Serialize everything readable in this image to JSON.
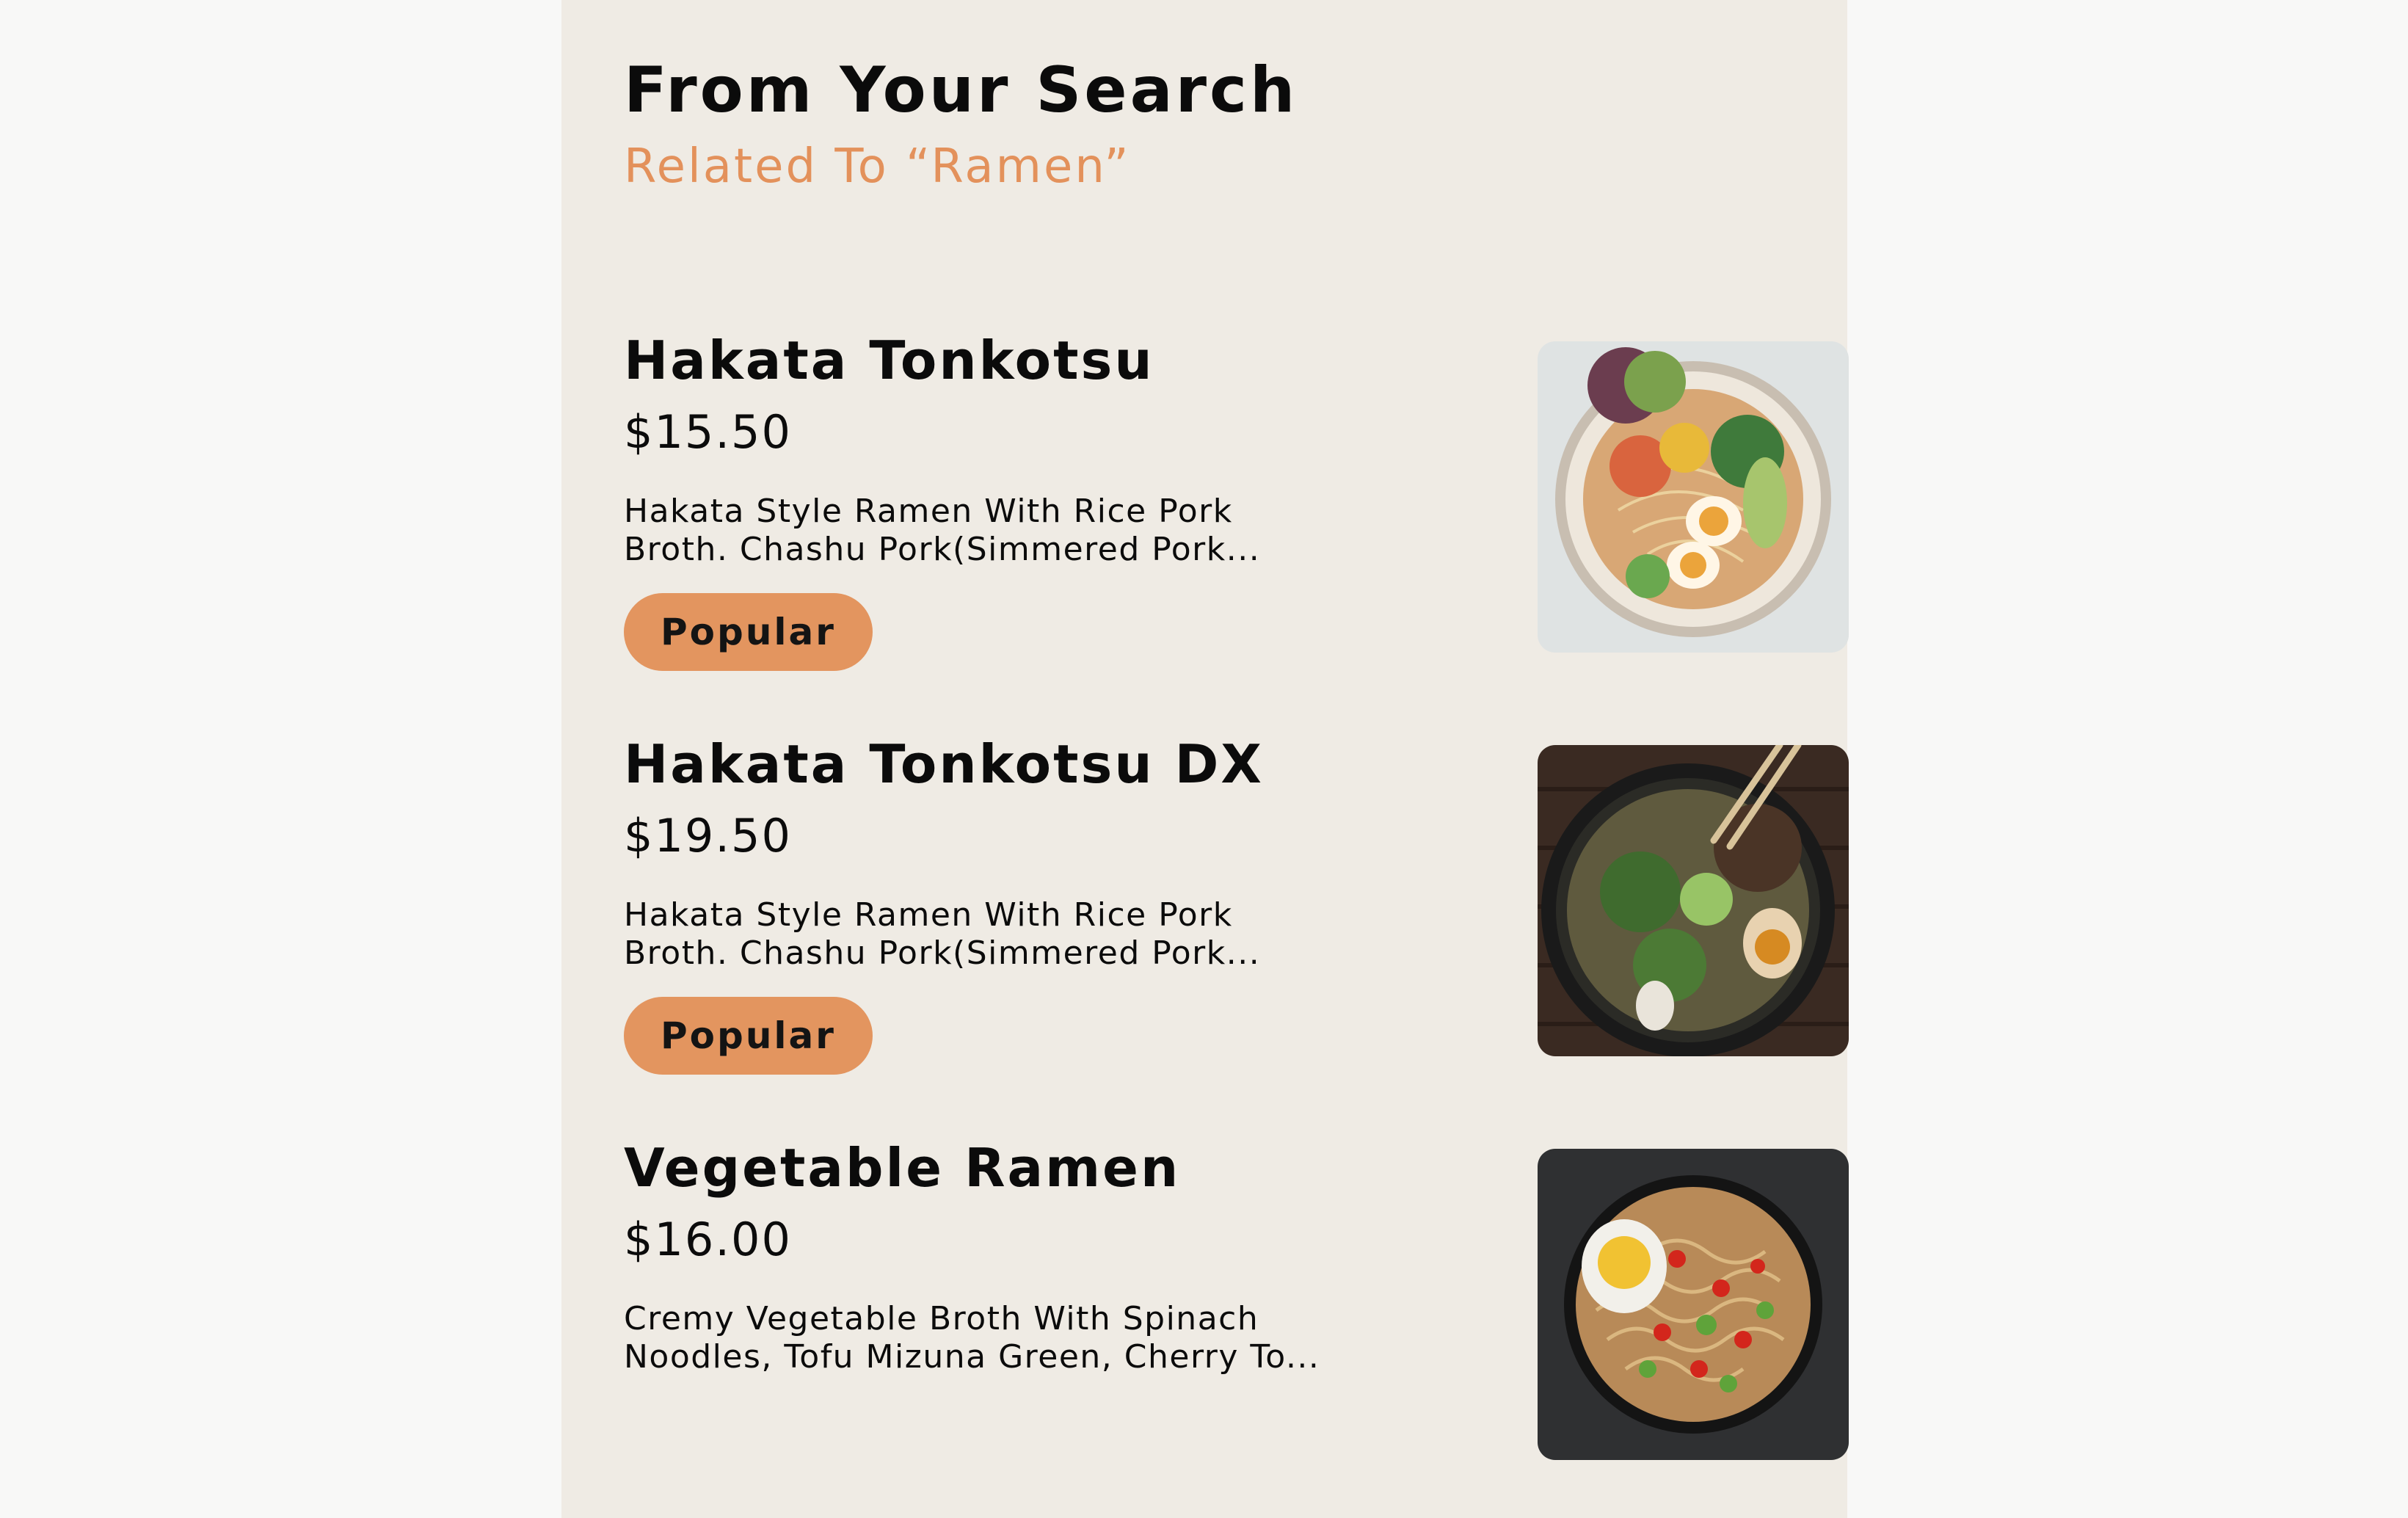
{
  "search": {
    "title": "From Your Search",
    "subtitle": "Related To “Ramen”"
  },
  "colors": {
    "page_background": "#f8f8f7",
    "panel_background": "#efebe4",
    "accent": "#e3915b",
    "badge": "#e3955f",
    "text": "#0b0b0b"
  },
  "items": [
    {
      "name": "Hakata Tonkotsu",
      "price": "$15.50",
      "description": "Hakata Style Ramen With Rice Pork\nBroth. Chashu Pork(Simmered Pork...",
      "badge": "Popular",
      "image_icon": "ramen-bowl-light-photo"
    },
    {
      "name": "Hakata Tonkotsu DX",
      "price": "$19.50",
      "description": "Hakata Style Ramen With Rice Pork\nBroth. Chashu Pork(Simmered Pork...",
      "badge": "Popular",
      "image_icon": "ramen-bowl-dark-wood-photo"
    },
    {
      "name": "Vegetable Ramen",
      "price": "$16.00",
      "description": "Cremy Vegetable Broth With Spinach\nNoodles, Tofu Mizuna Green, Cherry To...",
      "image_icon": "ramen-bowl-dark-slate-photo"
    }
  ]
}
